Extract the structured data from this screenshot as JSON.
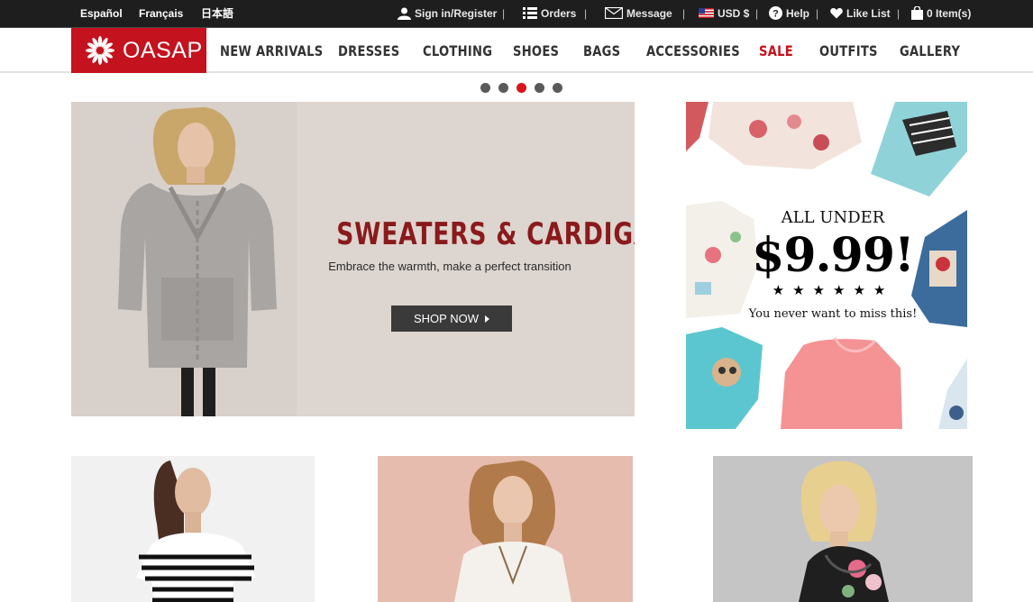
{
  "topbar": {
    "languages": [
      "Español",
      "Français",
      "日本語"
    ],
    "sign_in": "Sign in/Register",
    "orders": "Orders",
    "message": "Message",
    "currency": "USD $",
    "help": "Help",
    "like_list": "Like List",
    "cart": "0 Item(s)",
    "separator": "|"
  },
  "header": {
    "logo": "OASAP",
    "nav": [
      "NEW ARRIVALS",
      "DRESSES",
      "CLOTHING",
      "SHOES",
      "BAGS",
      "ACCESSORIES",
      "SALE",
      "OUTFITS",
      "GALLERY"
    ]
  },
  "carousel": {
    "slide_count": 5,
    "active_index": 2
  },
  "hero": {
    "title": "SWEATERS & CARDIGANS",
    "subtitle": "Embrace the warmth, make a perfect transition",
    "button": "SHOP NOW"
  },
  "promo": {
    "line1": "ALL UNDER",
    "price": "$9.99!",
    "stars": "★★★★★★",
    "line2": "You never want to miss this!"
  },
  "colors": {
    "brand": "#c4121e",
    "topbar": "#1e1e1e",
    "hero_bg": "#ddd5cf",
    "title": "#8a1a1c"
  }
}
